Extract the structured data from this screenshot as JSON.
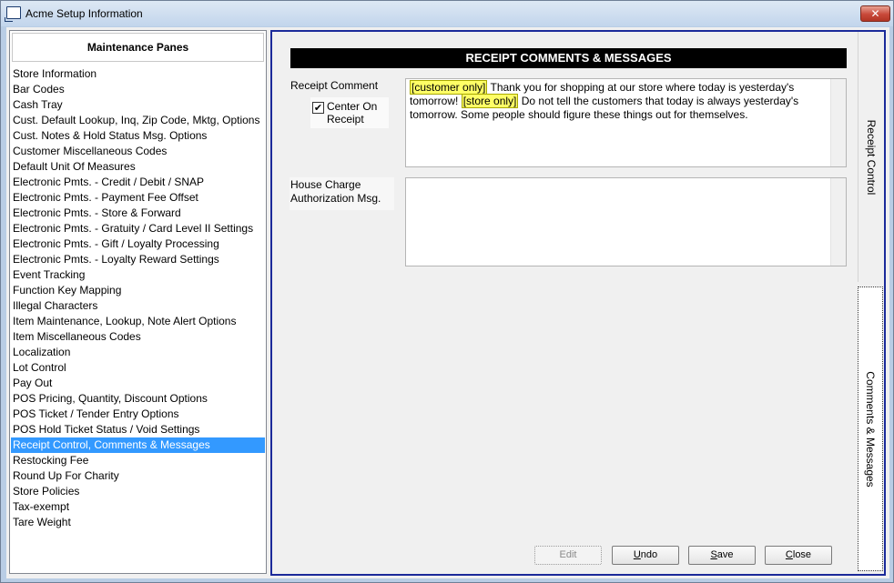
{
  "window": {
    "title": "Acme Setup Information",
    "close_glyph": "✕"
  },
  "left_panel": {
    "header": "Maintenance Panes",
    "items": [
      "Store Information",
      "Bar Codes",
      "Cash Tray",
      "Cust. Default Lookup, Inq, Zip Code, Mktg, Options",
      "Cust. Notes & Hold Status Msg. Options",
      "Customer Miscellaneous Codes",
      "Default Unit Of Measures",
      "Electronic Pmts. - Credit / Debit / SNAP",
      "Electronic Pmts. - Payment Fee Offset",
      "Electronic Pmts. - Store & Forward",
      "Electronic Pmts. - Gratuity / Card Level II Settings",
      "Electronic Pmts. - Gift / Loyalty Processing",
      "Electronic Pmts. - Loyalty Reward Settings",
      "Event Tracking",
      "Function Key Mapping",
      "Illegal Characters",
      "Item Maintenance, Lookup, Note Alert Options",
      "Item Miscellaneous Codes",
      "Localization",
      "Lot Control",
      "Pay Out",
      "POS Pricing, Quantity, Discount Options",
      "POS Ticket / Tender Entry Options",
      "POS Hold Ticket Status / Void Settings",
      "Receipt Control, Comments & Messages",
      "Restocking Fee",
      "Round Up For Charity",
      "Store Policies",
      "Tax-exempt",
      "Tare Weight"
    ],
    "selected_index": 24
  },
  "main": {
    "section_title": "RECEIPT COMMENTS & MESSAGES",
    "receipt_comment_label": "Receipt Comment",
    "center_on_receipt": {
      "checked": true,
      "check_glyph": "✔",
      "label_line1": "Center On",
      "label_line2": "Receipt"
    },
    "receipt_comment_text": {
      "tag1": "[customer only]",
      "text1": " Thank you for shopping at our store where today is yesterday's tomorrow! ",
      "tag2": "[store only]",
      "text2": " Do not tell the customers that today is always yesterday's tomorrow. Some people should figure these things out for themselves."
    },
    "house_charge_label_line1": "House Charge",
    "house_charge_label_line2": "Authorization Msg.",
    "house_charge_text": ""
  },
  "tabs": [
    {
      "label": "Receipt Control",
      "active": false
    },
    {
      "label": "Comments & Messages",
      "active": true
    }
  ],
  "buttons": {
    "edit": "Edit",
    "undo_first": "U",
    "undo_rest": "ndo",
    "save_first": "S",
    "save_rest": "ave",
    "close_first": "C",
    "close_rest": "lose"
  }
}
